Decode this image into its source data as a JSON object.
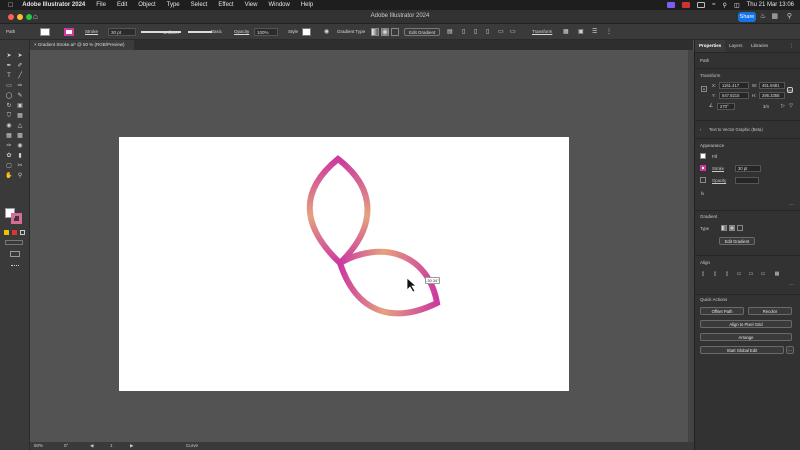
{
  "menubar": {
    "app": "Adobe Illustrator 2024",
    "items": [
      "File",
      "Edit",
      "Object",
      "Type",
      "Select",
      "Effect",
      "View",
      "Window",
      "Help"
    ],
    "datetime": "Thu 21 Mar  13:06"
  },
  "titlebar": {
    "title": "Adobe Illustrator 2024",
    "share": "Share"
  },
  "control": {
    "object": "Path",
    "stroke_label": "Stroke",
    "stroke_weight": "30 pt",
    "profile": "Uniform",
    "brush": "Basic",
    "opacity_label": "Opacity",
    "opacity": "100%",
    "style_label": "Style",
    "gradient_type_label": "Gradient Type",
    "edit_gradient": "Edit Gradient",
    "transform": "Transform"
  },
  "document": {
    "tab_title": "Gradient Stroke.ai* @ 50 % (RGB/Preview)"
  },
  "canvas": {
    "rotation_tip": "-30.34°",
    "stroke_colors": {
      "dark": "#cc3aa0",
      "light": "#e5a27e"
    }
  },
  "status": {
    "zoom": "50%",
    "rotation": "0°",
    "artboard": "1",
    "mode": "Curve"
  },
  "panel": {
    "tabs": [
      "Properties",
      "Layers",
      "Libraries"
    ],
    "path_label": "Path",
    "transform": {
      "heading": "Transform",
      "x_label": "X:",
      "x": "1161.417",
      "y_label": "Y:",
      "y": "547.8215",
      "w_label": "W:",
      "w": "451.9481",
      "h_label": "H:",
      "h": "286.3358",
      "angle": "270°",
      "ratio": "3/4"
    },
    "text_to_vector": "Text to Vector Graphic (Beta)",
    "appearance": {
      "heading": "Appearance",
      "fill_label": "Fill",
      "stroke_label": "Stroke",
      "stroke_value": "30 pt",
      "opacity_label": "Opacity",
      "opacity_value": "100%",
      "fx": "fx"
    },
    "gradient": {
      "heading": "Gradient",
      "type_label": "Type",
      "edit": "Edit Gradient"
    },
    "align": {
      "heading": "Align"
    },
    "quick": {
      "heading": "Quick Actions",
      "offset": "Offset Path",
      "recolor": "Recolor",
      "align_pixel": "Align to Pixel Grid",
      "arrange": "Arrange",
      "global_edit": "Start Global Edit"
    }
  }
}
